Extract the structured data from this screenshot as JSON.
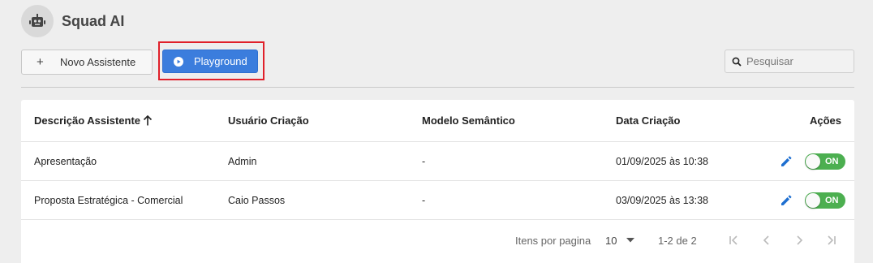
{
  "app": {
    "title": "Squad AI",
    "icon": "robot-icon"
  },
  "toolbar": {
    "new_assistant_label": "Novo Assistente",
    "new_assistant_icon": "+",
    "playground_label": "Playground",
    "search_placeholder": "Pesquisar"
  },
  "table": {
    "headers": {
      "description": "Descrição Assistente",
      "user": "Usuário Criação",
      "model": "Modelo Semântico",
      "date": "Data Criação",
      "actions": "Ações"
    },
    "sort": {
      "column": "description",
      "direction": "ascending"
    },
    "rows": [
      {
        "description": "Apresentação",
        "user": "Admin",
        "model": "-",
        "date": "01/09/2025 às 10:38",
        "toggle": "ON"
      },
      {
        "description": "Proposta Estratégica - Comercial",
        "user": "Caio Passos",
        "model": "-",
        "date": "03/09/2025 às 13:38",
        "toggle": "ON"
      }
    ]
  },
  "pagination": {
    "items_per_page_label": "Itens por pagina",
    "items_per_page": "10",
    "range": "1-2 de 2"
  },
  "colors": {
    "primary": "#3b7ddd",
    "toggle_on": "#4caf50",
    "highlight": "#e0202a",
    "edit_icon": "#1e6fd0"
  }
}
